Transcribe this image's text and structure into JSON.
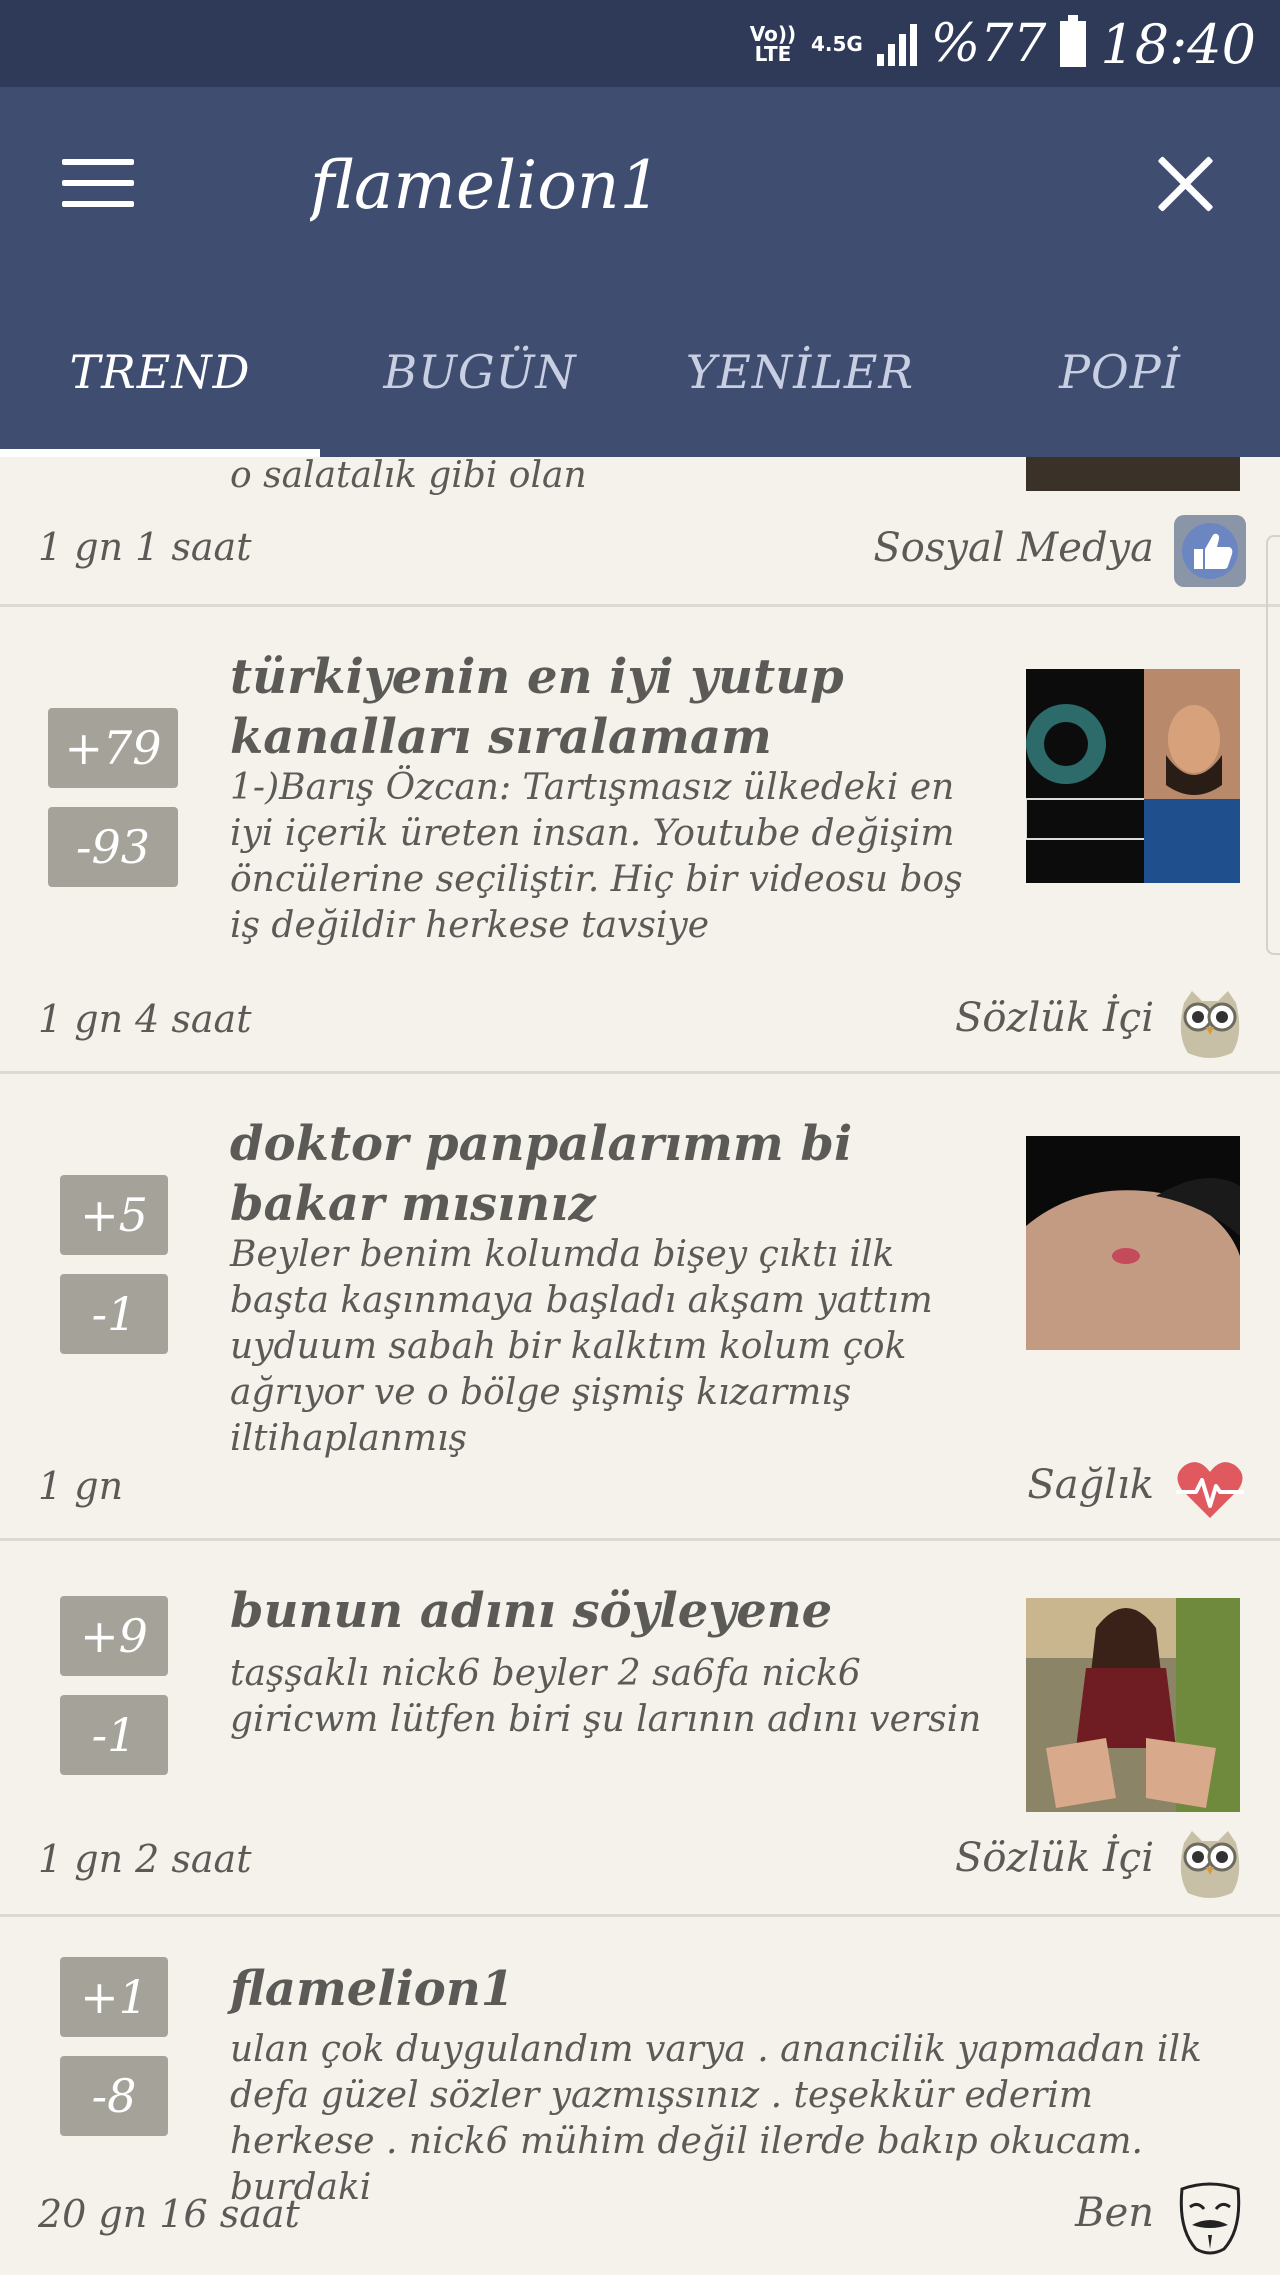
{
  "status": {
    "volte": "Vo)) LTE",
    "network": "4.5G",
    "battery": "%77",
    "time": "18:40"
  },
  "search": {
    "value": "flamelion1"
  },
  "tabs": [
    "TREND",
    "BUGÜN",
    "YENİLER",
    "POPİ"
  ],
  "feed": {
    "partial": {
      "excerpt": "o salatalık gibi olan",
      "time": "1 gn 1 saat",
      "category": "Sosyal Medya",
      "category_icon": "thumbs-up-icon"
    },
    "items": [
      {
        "up": "+79",
        "down": "-93",
        "title": "türkiyenin en iyi yutup kanalları sıralamam",
        "excerpt": "1-)Barış Özcan: Tartışmasız ülkedeki en iyi içerik üreten insan. Youtube değişim öncülerine seçiliştir. Hiç bir videosu boş iş değildir herkese tavsiye",
        "time": "1 gn 4 saat",
        "category": "Sözlük İçi",
        "category_icon": "owl-icon"
      },
      {
        "up": "+5",
        "down": "-1",
        "title": "doktor panpalarımm bi bakar mısınız",
        "excerpt": "Beyler benim kolumda bişey çıktı ilk başta kaşınmaya başladı akşam yattım uyduum sabah bir kalktım kolum çok ağrıyor ve o bölge şişmiş kızarmış iltihaplanmış",
        "time": "1 gn",
        "category": "Sağlık",
        "category_icon": "heartbeat-icon"
      },
      {
        "up": "+9",
        "down": "-1",
        "title": "bunun adını söyleyene",
        "excerpt": "taşşaklı nick6 beyler 2 sa6fa nick6 giricwm lütfen biri şu larının adını versin",
        "time": "1 gn 2 saat",
        "category": "Sözlük İçi",
        "category_icon": "owl-icon"
      },
      {
        "up": "+1",
        "down": "-8",
        "title": "flamelion1",
        "excerpt": "ulan çok duygulandım varya . anancilik yapmadan ilk defa güzel sözler yazmışsınız . teşekkür ederim herkese . nick6 mühim değil ilerde bakıp okucam. burdaki",
        "time": "20 gn 16 saat",
        "category": "Ben",
        "category_icon": "mask-icon"
      }
    ]
  },
  "colors": {
    "statusbar": "#2e3a58",
    "appbar": "#3f4d71",
    "background": "#f4f2ea",
    "vote_button": "#a5a399",
    "heart": "#e0595f"
  }
}
